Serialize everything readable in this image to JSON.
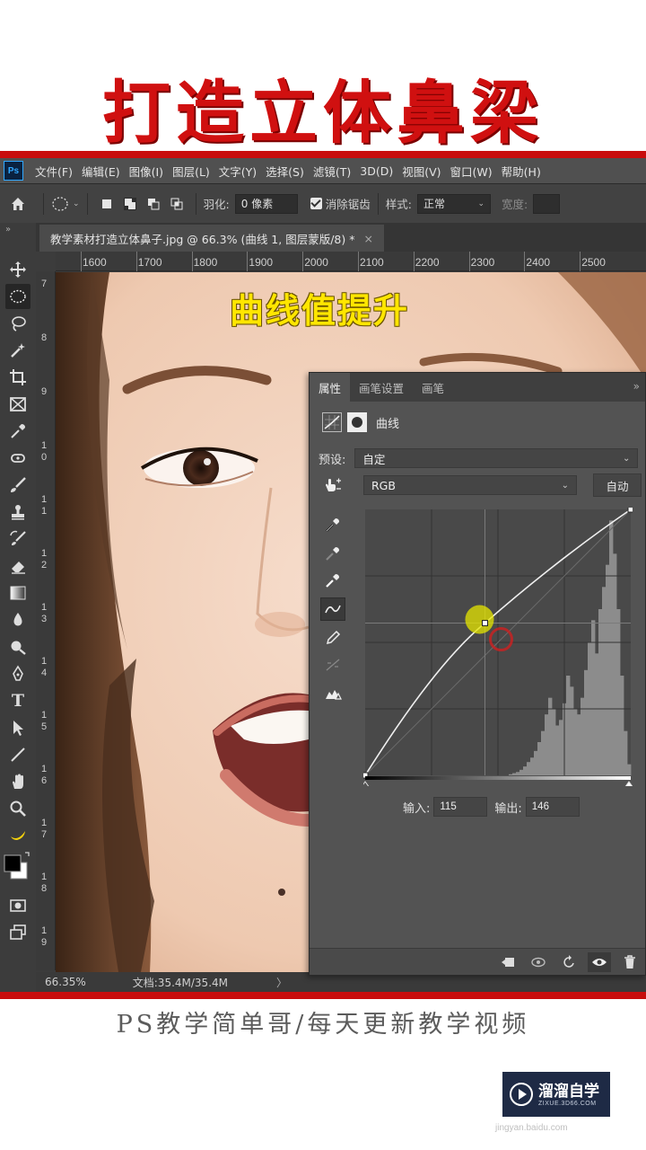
{
  "headline": "打造立体鼻梁",
  "menubar": {
    "logo": "Ps",
    "items": [
      "文件(F)",
      "编辑(E)",
      "图像(I)",
      "图层(L)",
      "文字(Y)",
      "选择(S)",
      "滤镜(T)",
      "3D(D)",
      "视图(V)",
      "窗口(W)",
      "帮助(H)"
    ]
  },
  "options_bar": {
    "feather_label": "羽化:",
    "feather_value": "0 像素",
    "antialias_label": "消除锯齿",
    "antialias_checked": true,
    "style_label": "样式:",
    "style_value": "正常",
    "width_label": "宽度:"
  },
  "document_tab": {
    "title": "教学素材打造立体鼻子.jpg @ 66.3% (曲线 1, 图层蒙版/8) *",
    "close": "×"
  },
  "ruler_top": [
    "1600",
    "1700",
    "1800",
    "1900",
    "2000",
    "2100",
    "2200",
    "2300",
    "2400",
    "2500"
  ],
  "ruler_left": [
    "7",
    "8",
    "9",
    "1 0",
    "1 1",
    "1 2",
    "1 3",
    "1 4",
    "1 5",
    "1 6",
    "1 7",
    "1 8",
    "1 9"
  ],
  "canvas_overlay_text": "曲线值提升",
  "status_bar": {
    "zoom": "66.35%",
    "doc_info": "文档:35.4M/35.4M",
    "arrow": "〉"
  },
  "properties_panel": {
    "tabs": [
      "属性",
      "画笔设置",
      "画笔"
    ],
    "more": "»",
    "title": "曲线",
    "preset_label": "预设:",
    "preset_value": "自定",
    "channel_value": "RGB",
    "auto_button": "自动",
    "input_label": "输入:",
    "input_value": "115",
    "output_label": "输出:",
    "output_value": "146"
  },
  "curve": {
    "control_point": {
      "input": 115,
      "output": 146
    },
    "endpoints": [
      [
        0,
        0
      ],
      [
        255,
        255
      ]
    ]
  },
  "caption": "PS教学简单哥/每天更新教学视频",
  "watermark": {
    "name": "溜溜自学",
    "domain": "ZIXUE.3D66.COM",
    "source": "jingyan.baidu.com"
  },
  "colors": {
    "brand_red": "#c80d0d",
    "overlay_yellow": "#ffe600",
    "ps_blue": "#31a8ff"
  }
}
